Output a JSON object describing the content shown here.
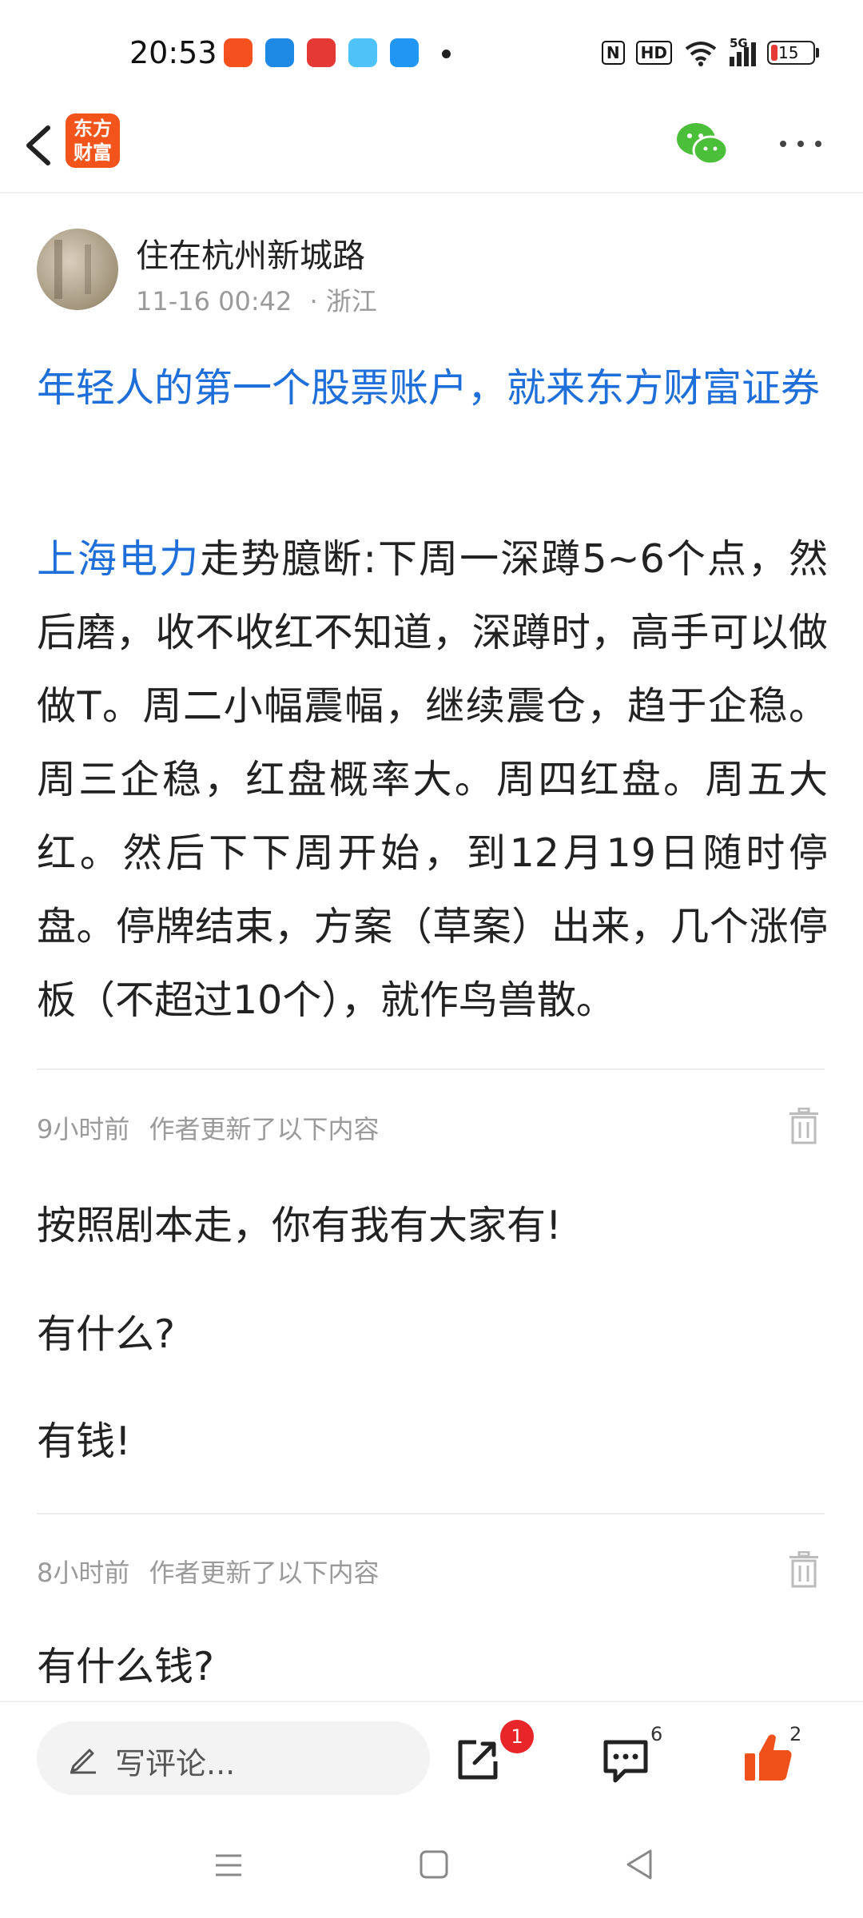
{
  "status_bar": {
    "time": "20:53",
    "app_icons": [
      {
        "name": "app-icon-1",
        "color": "#f4511e"
      },
      {
        "name": "app-icon-2",
        "color": "#1e88e5"
      },
      {
        "name": "app-icon-3",
        "color": "#e53935"
      },
      {
        "name": "app-icon-4",
        "color": "#4fc3f7"
      },
      {
        "name": "app-icon-5",
        "color": "#2196f3"
      }
    ],
    "nfc": "N",
    "hd": "HD",
    "network": "5G",
    "battery": "15"
  },
  "header": {
    "logo_line1": "东方",
    "logo_line2": "财富",
    "logo_color": "#f2541b"
  },
  "post": {
    "author": "住在杭州新城路",
    "time": "11-16 00:42",
    "location": "· 浙江",
    "title": "年轻人的第一个股票账户，就来东方财富证券",
    "stock_link": "上海电力",
    "body": "走势臆断:下周一深蹲5~6个点，然后磨，收不收红不知道，深蹲时，高手可以做做T。周二小幅震幅，继续震仓，趋于企稳。周三企稳，红盘概率大。周四红盘。周五大红。然后下下周开始，到12月19日随时停盘。停牌结束，方案（草案）出来，几个涨停板（不超过10个），就作鸟兽散。"
  },
  "updates": [
    {
      "time": "9小时前",
      "label": "作者更新了以下内容",
      "paragraphs": [
        "按照剧本走，你有我有大家有!",
        "有什么?",
        "有钱!"
      ]
    },
    {
      "time": "8小时前",
      "label": "作者更新了以下内容",
      "paragraphs": [
        "有什么钱?"
      ]
    }
  ],
  "bottom_bar": {
    "comment_placeholder": "写评论...",
    "share_badge": "1",
    "comment_count": "6",
    "like_count": "2",
    "like_color": "#f0501a",
    "accent_color": "#1e6fd9"
  }
}
